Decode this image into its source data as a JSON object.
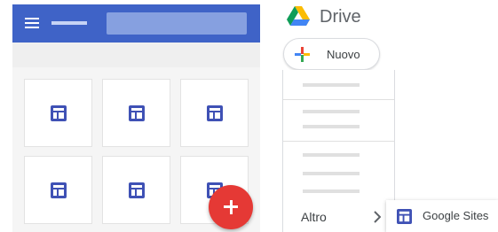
{
  "drive": {
    "title": "Drive",
    "new_button_label": "Nuovo",
    "menu": {
      "more_label": "Altro",
      "submenu_item_label": "Google Sites"
    }
  },
  "sites_mock": {
    "tile_count": 6
  },
  "colors": {
    "sites_header": "#3f63c7",
    "sites_icon": "#3f51b5",
    "fab": "#e53935"
  },
  "icons": {
    "menu": "hamburger-icon",
    "site_template": "sites-layout-icon",
    "add": "plus-icon",
    "drive": "google-drive-logo",
    "submenu_arrow": "chevron-right-icon"
  }
}
